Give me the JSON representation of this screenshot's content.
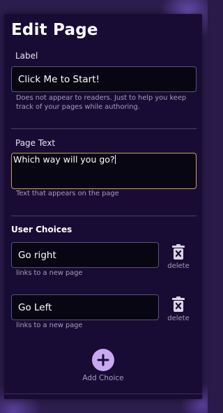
{
  "page": {
    "title": "Edit Page"
  },
  "label_field": {
    "label": "Label",
    "value": "Click Me to Start!",
    "help": "Does not appear to readers. Just to help you keep track of your pages while authoring."
  },
  "page_text_field": {
    "label": "Page Text",
    "value": "Which way will you go?",
    "help": "Text that appears on the page"
  },
  "choices": {
    "title": "User Choices",
    "items": [
      {
        "value": "Go right",
        "help": "links to a new page",
        "delete_label": "delete"
      },
      {
        "value": "Go Left",
        "help": "links to a new page",
        "delete_label": "delete"
      }
    ],
    "add_label": "Add Choice"
  },
  "colors": {
    "panel_bg": "#190c34",
    "input_bg": "#070612",
    "focus_border": "#c9a35a",
    "accent": "#c9a8f2"
  }
}
